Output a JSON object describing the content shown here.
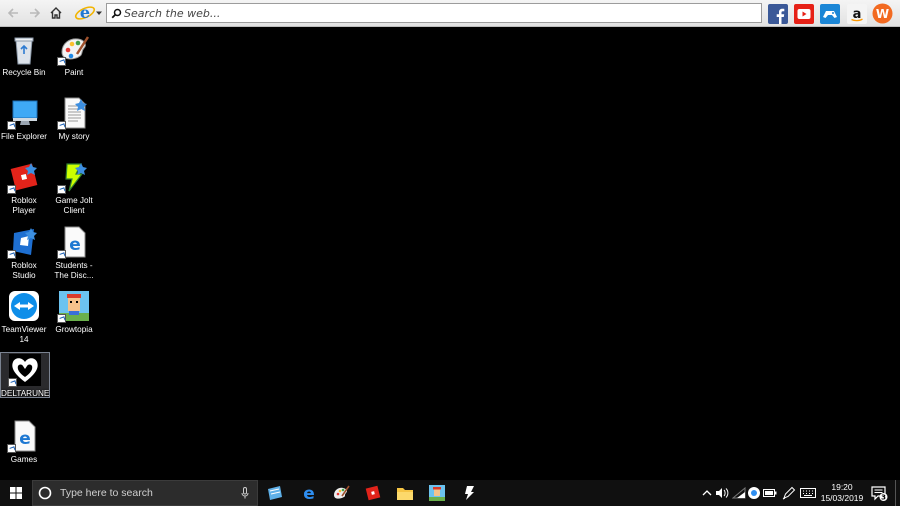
{
  "toolbar": {
    "search_placeholder": "Search the web...",
    "sites": [
      "facebook-icon",
      "youtube-icon",
      "game-controller-icon",
      "amazon-icon",
      "w-site-icon"
    ],
    "amazon_glyph": "a",
    "w_glyph": "W"
  },
  "desktop": {
    "icons": [
      {
        "label": "Recycle Bin"
      },
      {
        "label": "Paint"
      },
      {
        "label": "File Explorer"
      },
      {
        "label": "My story"
      },
      {
        "label": "Roblox Player"
      },
      {
        "label": "Game Jolt Client"
      },
      {
        "label": "Roblox Studio"
      },
      {
        "label": "Students - The Disc..."
      },
      {
        "label": "TeamViewer 14"
      },
      {
        "label": "Growtopia"
      },
      {
        "label": "DELTARUNE"
      },
      {
        "label": "Games"
      }
    ]
  },
  "taskbar": {
    "search_placeholder": "Type here to search",
    "clock_time": "19:20",
    "clock_date": "15/03/2019",
    "notification_count": "3"
  },
  "colors": {
    "facebook": "#3b5998",
    "youtube": "#e62117",
    "roblox_red": "#e2231a",
    "edge_blue": "#1e78d2",
    "teamviewer": "#0e8ee9"
  }
}
